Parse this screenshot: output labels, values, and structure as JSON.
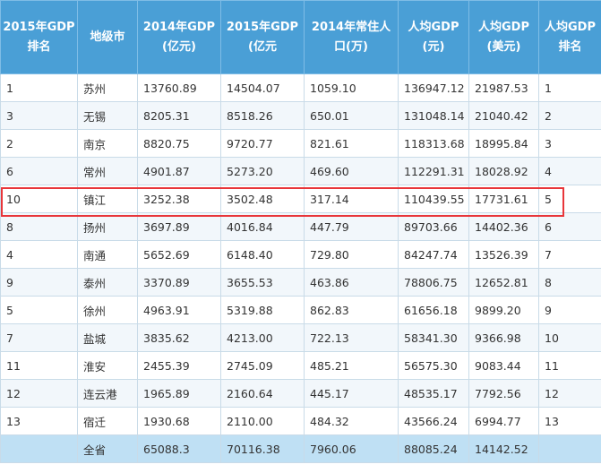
{
  "headers": [
    "2015年GDP排名",
    "地级市",
    "2014年GDP(亿元)",
    "2015年GDP(亿元",
    "2014年常住人口(万)",
    "人均GDP(元)",
    "人均GDP(美元)",
    "人均GDP排名"
  ],
  "rows": [
    [
      "1",
      "苏州",
      "13760.89",
      "14504.07",
      "1059.10",
      "136947.12",
      "21987.53",
      "1"
    ],
    [
      "3",
      "无锡",
      "8205.31",
      "8518.26",
      "650.01",
      "131048.14",
      "21040.42",
      "2"
    ],
    [
      "2",
      "南京",
      "8820.75",
      "9720.77",
      "821.61",
      "118313.68",
      "18995.84",
      "3"
    ],
    [
      "6",
      "常州",
      "4901.87",
      "5273.20",
      "469.60",
      "112291.31",
      "18028.92",
      "4"
    ],
    [
      "10",
      "镇江",
      "3252.38",
      "3502.48",
      "317.14",
      "110439.55",
      "17731.61",
      "5"
    ],
    [
      "8",
      "扬州",
      "3697.89",
      "4016.84",
      "447.79",
      "89703.66",
      "14402.36",
      "6"
    ],
    [
      "4",
      "南通",
      "5652.69",
      "6148.40",
      "729.80",
      "84247.74",
      "13526.39",
      "7"
    ],
    [
      "9",
      "泰州",
      "3370.89",
      "3655.53",
      "463.86",
      "78806.75",
      "12652.81",
      "8"
    ],
    [
      "5",
      "徐州",
      "4963.91",
      "5319.88",
      "862.83",
      "61656.18",
      "9899.20",
      "9"
    ],
    [
      "7",
      "盐城",
      "3835.62",
      "4213.00",
      "722.13",
      "58341.30",
      "9366.98",
      "10"
    ],
    [
      "11",
      "淮安",
      "2455.39",
      "2745.09",
      "485.21",
      "56575.30",
      "9083.44",
      "11"
    ],
    [
      "12",
      "连云港",
      "1965.89",
      "2160.64",
      "445.17",
      "48535.17",
      "7792.56",
      "12"
    ],
    [
      "13",
      "宿迁",
      "1930.68",
      "2110.00",
      "484.32",
      "43566.24",
      "6994.77",
      "13"
    ]
  ],
  "total_row": [
    "",
    "全省",
    "65088.3",
    "70116.38",
    "7960.06",
    "88085.24",
    "14142.52",
    ""
  ],
  "highlighted_row": "镇江",
  "colors": {
    "header_bg": "#4a9fd6",
    "highlight_border": "#e8363a",
    "total_bg": "#bfe0f4"
  }
}
